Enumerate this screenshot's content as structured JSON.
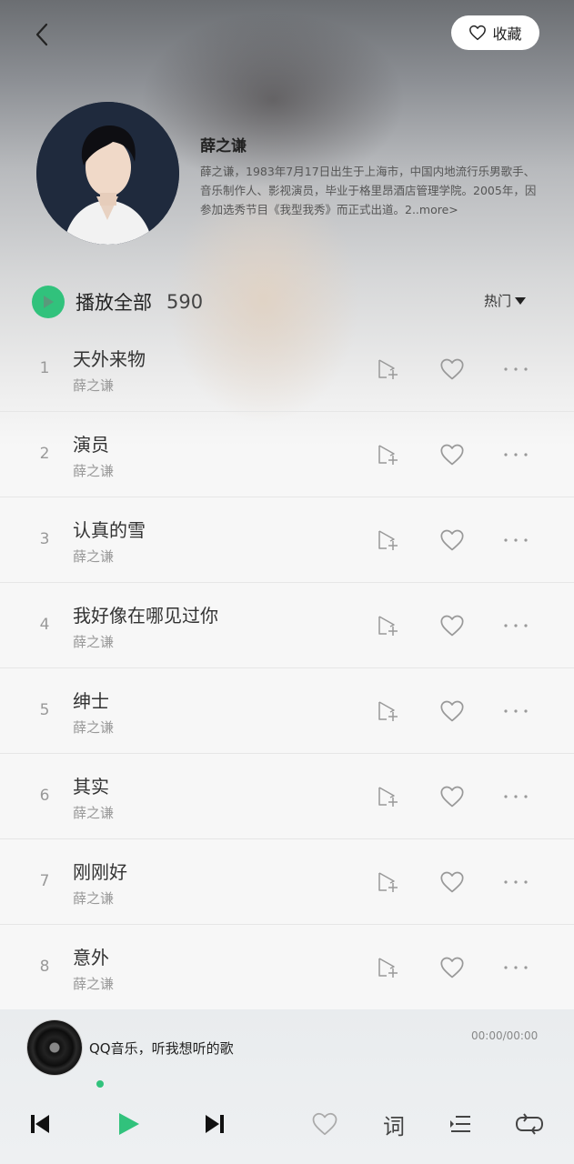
{
  "header": {
    "favorite_label": "收藏"
  },
  "artist": {
    "name": "薛之谦",
    "bio": "薛之谦，1983年7月17日出生于上海市，中国内地流行乐男歌手、音乐制作人、影视演员，毕业于格里昂酒店管理学院。2005年，因参加选秀节目《我型我秀》而正式出道。2..more>"
  },
  "playlist": {
    "play_all_label": "播放全部",
    "count": "590",
    "sort_label": "热门"
  },
  "songs": [
    {
      "index": "1",
      "title": "天外来物",
      "artist": "薛之谦"
    },
    {
      "index": "2",
      "title": "演员",
      "artist": "薛之谦"
    },
    {
      "index": "3",
      "title": "认真的雪",
      "artist": "薛之谦"
    },
    {
      "index": "4",
      "title": "我好像在哪见过你",
      "artist": "薛之谦"
    },
    {
      "index": "5",
      "title": "绅士",
      "artist": "薛之谦"
    },
    {
      "index": "6",
      "title": "其实",
      "artist": "薛之谦"
    },
    {
      "index": "7",
      "title": "刚刚好",
      "artist": "薛之谦"
    },
    {
      "index": "8",
      "title": "意外",
      "artist": "薛之谦"
    }
  ],
  "player": {
    "now_playing": "QQ音乐，听我想听的歌",
    "time": "00:00/00:00",
    "lyrics_label": "词"
  },
  "colors": {
    "accent": "#31c27c",
    "icon_gray": "#999999"
  }
}
